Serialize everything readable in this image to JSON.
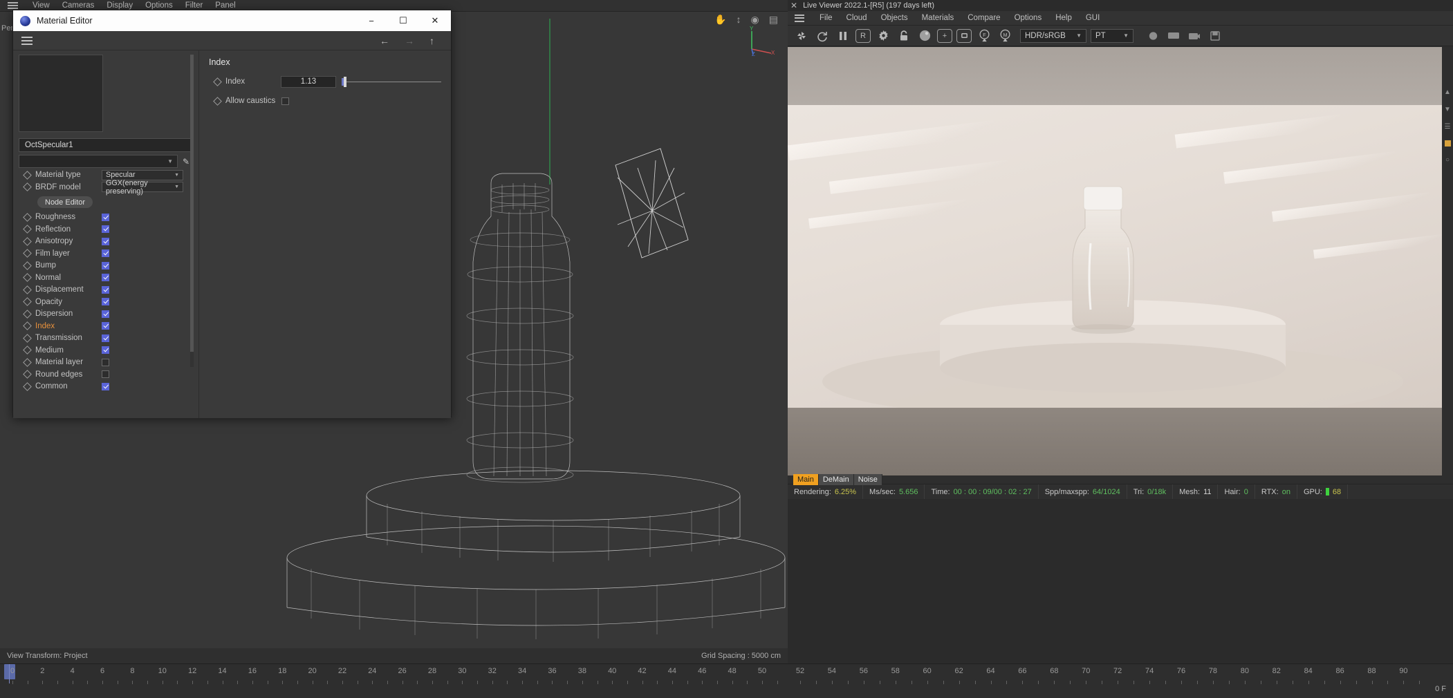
{
  "host_app": {
    "menubar": {
      "hamburger_icon": "hamburger-menu-icon",
      "items": [
        "View",
        "Cameras",
        "Display",
        "Options",
        "Filter",
        "Panel"
      ]
    },
    "viewport": {
      "persp_label": "Pers",
      "top_icons": [
        "hand-icon",
        "move-vertical-icon",
        "orbit-icon",
        "frame-icon"
      ],
      "axis": {
        "y": "Y",
        "x": "X",
        "z": "Z"
      }
    },
    "footer": {
      "view_transform": "View Transform: Project",
      "grid_spacing": "Grid Spacing : 5000 cm"
    },
    "timeline": {
      "ticks": [
        "0",
        "2",
        "4",
        "6",
        "8",
        "10",
        "12",
        "14",
        "16",
        "18",
        "20",
        "22",
        "24",
        "26",
        "28",
        "30",
        "32",
        "34",
        "36",
        "38",
        "40",
        "42",
        "44",
        "46",
        "48",
        "50"
      ]
    }
  },
  "material_editor": {
    "title": "Material Editor",
    "title_icon": "octane-sphere-icon",
    "window_buttons": {
      "minimize": "−",
      "maximize": "☐",
      "close": "✕"
    },
    "toolbar": {
      "hamburger_icon": "hamburger-menu-icon",
      "nav_back": "←",
      "nav_forward": "→",
      "nav_up": "↑"
    },
    "material_name": "OctSpecular1",
    "search_placeholder": "",
    "eyedropper_icon": "eyedropper-icon",
    "combos": [
      {
        "label": "Material type",
        "value": "Specular"
      },
      {
        "label": "BRDF model",
        "value": "GGX(energy preserving)"
      }
    ],
    "node_editor_button": "Node Editor",
    "channels": [
      {
        "label": "Roughness",
        "checked": true
      },
      {
        "label": "Reflection",
        "checked": true
      },
      {
        "label": "Anisotropy",
        "checked": true
      },
      {
        "label": "Film layer",
        "checked": true
      },
      {
        "label": "Bump",
        "checked": true
      },
      {
        "label": "Normal",
        "checked": true
      },
      {
        "label": "Displacement",
        "checked": true
      },
      {
        "label": "Opacity",
        "checked": true
      },
      {
        "label": "Dispersion",
        "checked": true
      },
      {
        "label": "Index",
        "checked": true,
        "active": true
      },
      {
        "label": "Transmission",
        "checked": true
      },
      {
        "label": "Medium",
        "checked": true
      },
      {
        "label": "Material layer",
        "checked": false
      },
      {
        "label": "Round edges",
        "checked": false
      },
      {
        "label": "Common",
        "checked": true
      }
    ],
    "index_panel": {
      "heading": "Index",
      "index_label": "Index",
      "index_value": "1.13",
      "allow_caustics_label": "Allow caustics",
      "allow_caustics_checked": false
    }
  },
  "live_viewer": {
    "title": "Live Viewer 2022.1-[R5] (197 days left)",
    "close_icon": "close-icon",
    "menubar": {
      "hamburger_icon": "hamburger-menu-icon",
      "items": [
        "File",
        "Cloud",
        "Objects",
        "Materials",
        "Compare",
        "Options",
        "Help",
        "GUI"
      ]
    },
    "toolbar": {
      "icons": [
        "restart-render-icon",
        "refresh-icon",
        "pause-icon",
        "region-render-icon",
        "settings-gear-icon",
        "lock-icon",
        "sphere-icon",
        "add-region-icon",
        "subtract-region-icon",
        "focus-picker-icon",
        "material-picker-icon"
      ],
      "color_space": "HDR/sRGB",
      "kernel": "PT",
      "right_icons": [
        "render-passes-icon",
        "film-icon",
        "camera-icon",
        "save-icon"
      ]
    },
    "tabs": [
      {
        "label": "Main",
        "active": true
      },
      {
        "label": "DeMain",
        "active": false
      },
      {
        "label": "Noise",
        "active": false
      }
    ],
    "status": [
      {
        "key": "Rendering:",
        "value": "6.25%",
        "color": "amber"
      },
      {
        "key": "Ms/sec:",
        "value": "5.656",
        "color": "green"
      },
      {
        "key": "Time:",
        "value": "00 : 00 : 09/00 : 02 : 27",
        "color": "green"
      },
      {
        "key": "Spp/maxspp:",
        "value": "64/1024",
        "color": "green"
      },
      {
        "key": "Tri:",
        "value": "0/18k",
        "color": "green"
      },
      {
        "key": "Mesh:",
        "value": "11",
        "color": "plain"
      },
      {
        "key": "Hair:",
        "value": "0",
        "color": "green"
      },
      {
        "key": "RTX:",
        "value": "on",
        "color": "green"
      },
      {
        "key": "GPU:",
        "value": "68",
        "color": "amber"
      }
    ],
    "bottom_ruler": {
      "ticks": [
        "52",
        "54",
        "56",
        "58",
        "60",
        "62",
        "64",
        "66",
        "68",
        "70",
        "72",
        "74",
        "76",
        "78",
        "80",
        "82",
        "84",
        "86",
        "88",
        "90"
      ],
      "frame_label": "0 F"
    },
    "right_rail_icons": [
      "chevron-up-icon",
      "chevron-down-icon",
      "layers-icon",
      "color-swatch-icon",
      "info-icon"
    ]
  },
  "colors": {
    "accent_orange": "#e8913c",
    "checkbox_blue": "#5a64d8",
    "status_green": "#5fbf5f",
    "status_amber": "#c9c44e",
    "tab_active": "#f0a020"
  }
}
